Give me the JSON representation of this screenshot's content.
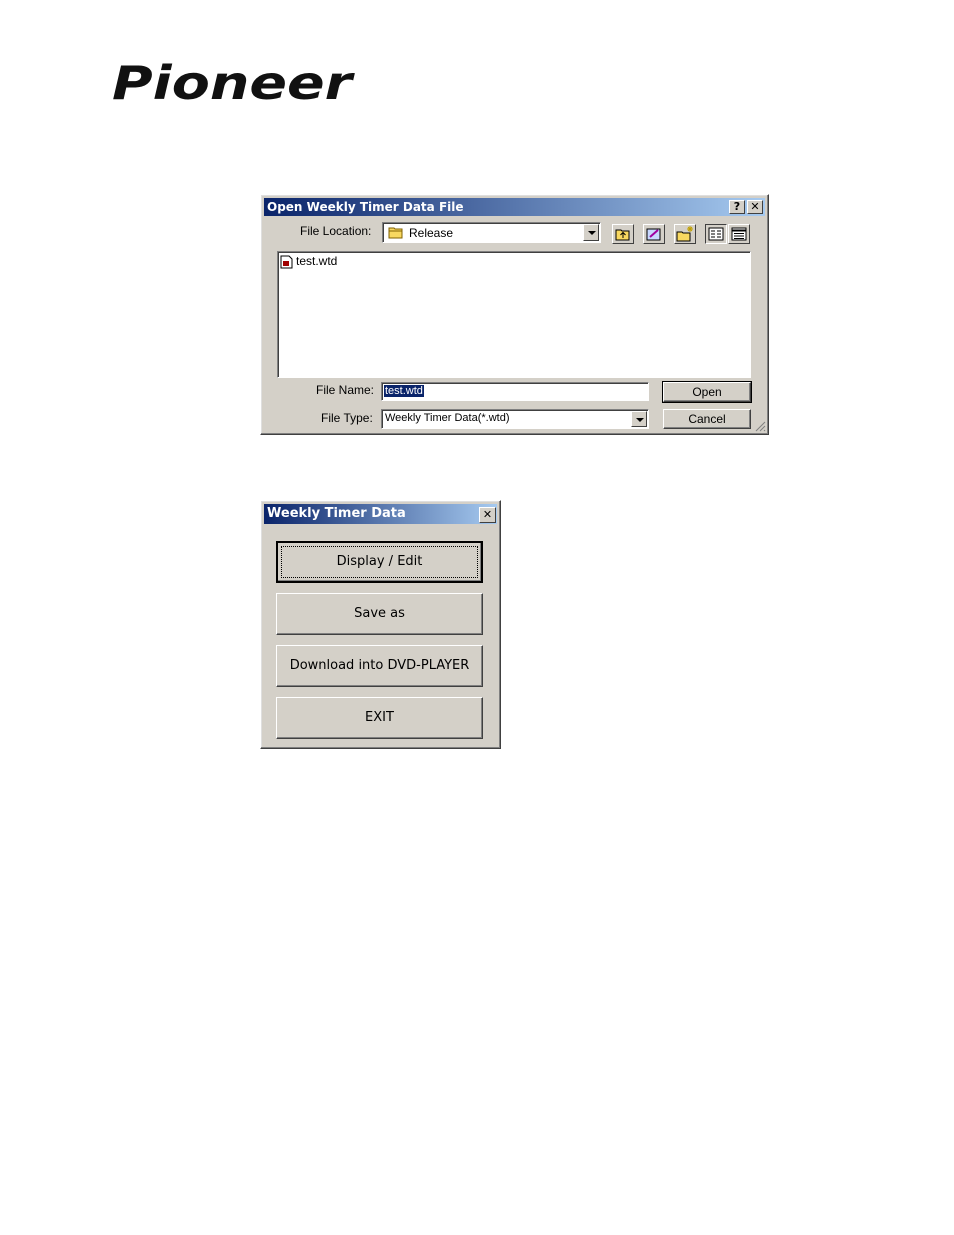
{
  "brand": {
    "logo_text": "Pioneer"
  },
  "open_dialog": {
    "title": "Open Weekly Timer Data File",
    "help_button": "?",
    "close_button": "✕",
    "location_label": "File Location:",
    "location_value": "Release",
    "files": [
      {
        "name": "test.wtd"
      }
    ],
    "file_name_label": "File Name:",
    "file_name_value": "test.wtd",
    "file_type_label": "File Type:",
    "file_type_value": "Weekly Timer Data(*.wtd)",
    "open_button": "Open",
    "cancel_button": "Cancel",
    "toolbar_icons": [
      "up-one-level-icon",
      "favorites-icon",
      "new-folder-icon",
      "list-view-icon",
      "details-view-icon"
    ]
  },
  "menu_window": {
    "title": "Weekly Timer Data",
    "close_button": "✕",
    "buttons": [
      {
        "label": "Display / Edit"
      },
      {
        "label": "Save as"
      },
      {
        "label": "Download into DVD-PLAYER"
      },
      {
        "label": "EXIT"
      }
    ]
  },
  "colors": {
    "titlebar_start": "#0a246a",
    "titlebar_end": "#a6caf0",
    "window_face": "#d4d0c8",
    "selection": "#0a246a"
  }
}
